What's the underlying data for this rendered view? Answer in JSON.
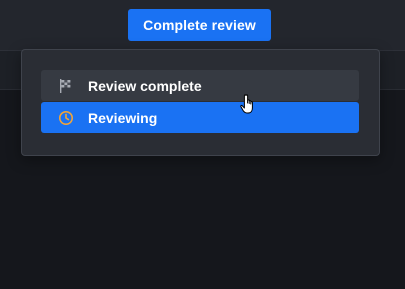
{
  "toolbar": {
    "complete_label": "Complete review"
  },
  "status_menu": {
    "items": [
      {
        "label": "Review complete",
        "icon": "checkered-flag-icon",
        "state": "hover"
      },
      {
        "label": "Reviewing",
        "icon": "clock-icon",
        "state": "selected"
      }
    ]
  },
  "colors": {
    "accent": "#1a72f3",
    "clock_icon": "#f0a43a",
    "background": "#15171c",
    "menu_bg": "#2a2d34"
  }
}
